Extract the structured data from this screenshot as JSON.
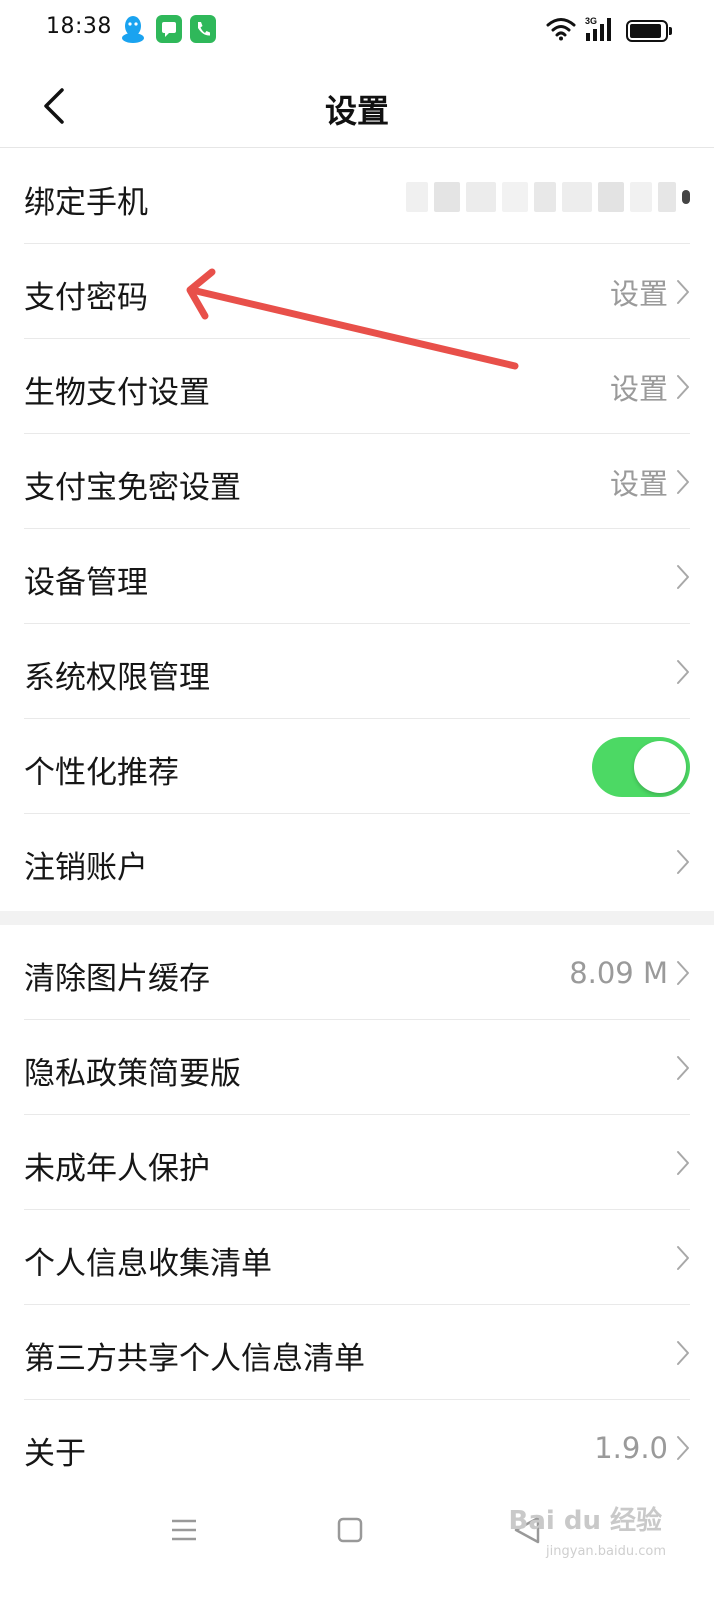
{
  "status_bar": {
    "time": "18:38",
    "network_type": "3G",
    "notification_icons": [
      "qq-icon",
      "message-icon",
      "phone-icon"
    ],
    "right_icons": [
      "wifi-icon",
      "signal-icon",
      "battery-icon"
    ],
    "battery_level": 0.95
  },
  "header": {
    "title": "设置",
    "back_icon": "back-chevron-icon"
  },
  "group1": {
    "items": [
      {
        "label": "绑定手机",
        "value": "",
        "masked": true
      },
      {
        "label": "支付密码",
        "value": "设置"
      },
      {
        "label": "生物支付设置",
        "value": "设置"
      },
      {
        "label": "支付宝免密设置",
        "value": "设置"
      },
      {
        "label": "设备管理",
        "value": ""
      },
      {
        "label": "系统权限管理",
        "value": ""
      },
      {
        "label": "个性化推荐",
        "toggle": true,
        "toggle_on": true
      },
      {
        "label": "注销账户",
        "value": ""
      }
    ]
  },
  "group2": {
    "items": [
      {
        "label": "清除图片缓存",
        "value": "8.09 M"
      },
      {
        "label": "隐私政策简要版",
        "value": ""
      },
      {
        "label": "未成年人保护",
        "value": ""
      },
      {
        "label": "个人信息收集清单",
        "value": ""
      },
      {
        "label": "第三方共享个人信息清单",
        "value": ""
      },
      {
        "label": "关于",
        "value": "1.9.0"
      }
    ]
  },
  "nav_bar": {
    "icons": [
      "menu-icon",
      "home-icon",
      "back-icon"
    ]
  },
  "watermark": {
    "text": "Bai du 经验",
    "subtext": "jingyan.baidu.com"
  },
  "colors": {
    "toggle_on": "#4cd964",
    "annotation_arrow": "#e8504a",
    "secondary_text": "#9a9a9a",
    "divider": "#e9e9e9",
    "section_gap": "#f2f2f2"
  }
}
